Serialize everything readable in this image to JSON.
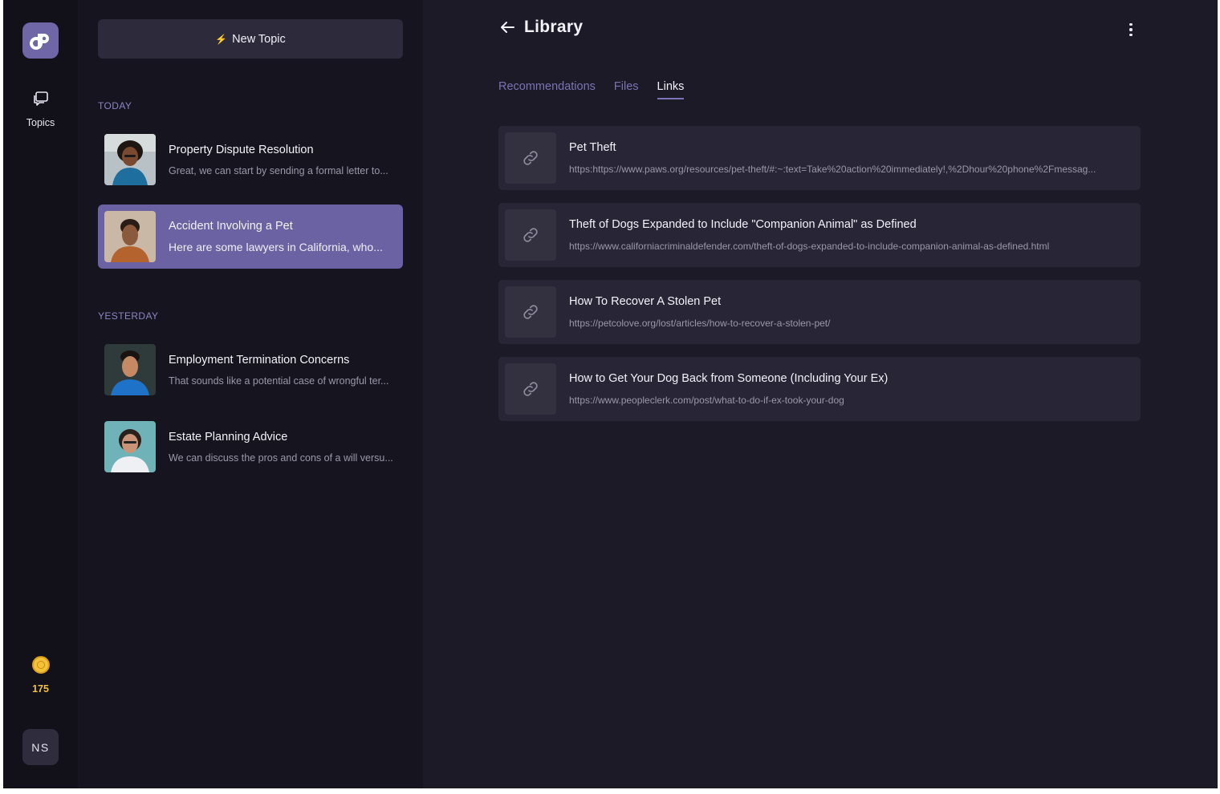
{
  "rail": {
    "logo_icon": "app-logo-icon",
    "topics_label": "Topics",
    "coins": "175",
    "user_initials": "NS"
  },
  "topics_panel": {
    "new_topic_label": "New Topic",
    "sections": [
      {
        "heading": "TODAY",
        "items": [
          {
            "title": "Property Dispute Resolution",
            "preview": "Great, we can start by sending a formal letter to...",
            "active": false
          },
          {
            "title": "Accident Involving a Pet",
            "preview": "Here are some lawyers in California, who...",
            "active": true
          }
        ]
      },
      {
        "heading": "YESTERDAY",
        "items": [
          {
            "title": "Employment Termination Concerns",
            "preview": "That sounds like a potential case of wrongful ter...",
            "active": false
          },
          {
            "title": "Estate Planning Advice",
            "preview": "We can discuss the pros and cons of a will versu...",
            "active": false
          }
        ]
      }
    ]
  },
  "main": {
    "title": "Library",
    "tabs": [
      {
        "label": "Recommendations",
        "active": false
      },
      {
        "label": "Files",
        "active": false
      },
      {
        "label": "Links",
        "active": true
      }
    ],
    "links": [
      {
        "title": "Pet Theft",
        "url": "https:https://www.paws.org/resources/pet-theft/#:~:text=Take%20action%20immediately!,%2Dhour%20phone%2Fmessag..."
      },
      {
        "title": "Theft of Dogs Expanded to Include \"Companion Animal\" as Defined",
        "url": "https://www.californiacriminaldefender.com/theft-of-dogs-expanded-to-include-companion-animal-as-defined.html"
      },
      {
        "title": "How To Recover A Stolen Pet",
        "url": "https://petcolove.org/lost/articles/how-to-recover-a-stolen-pet/"
      },
      {
        "title": "How to Get Your Dog Back from Someone (Including Your Ex)",
        "url": "https://www.peopleclerk.com/post/what-to-do-if-ex-took-your-dog"
      }
    ]
  },
  "colors": {
    "accent": "#6a62a3",
    "accent_text": "#7a73b6",
    "coin": "#f3c13a",
    "background": "#1b1a26"
  }
}
